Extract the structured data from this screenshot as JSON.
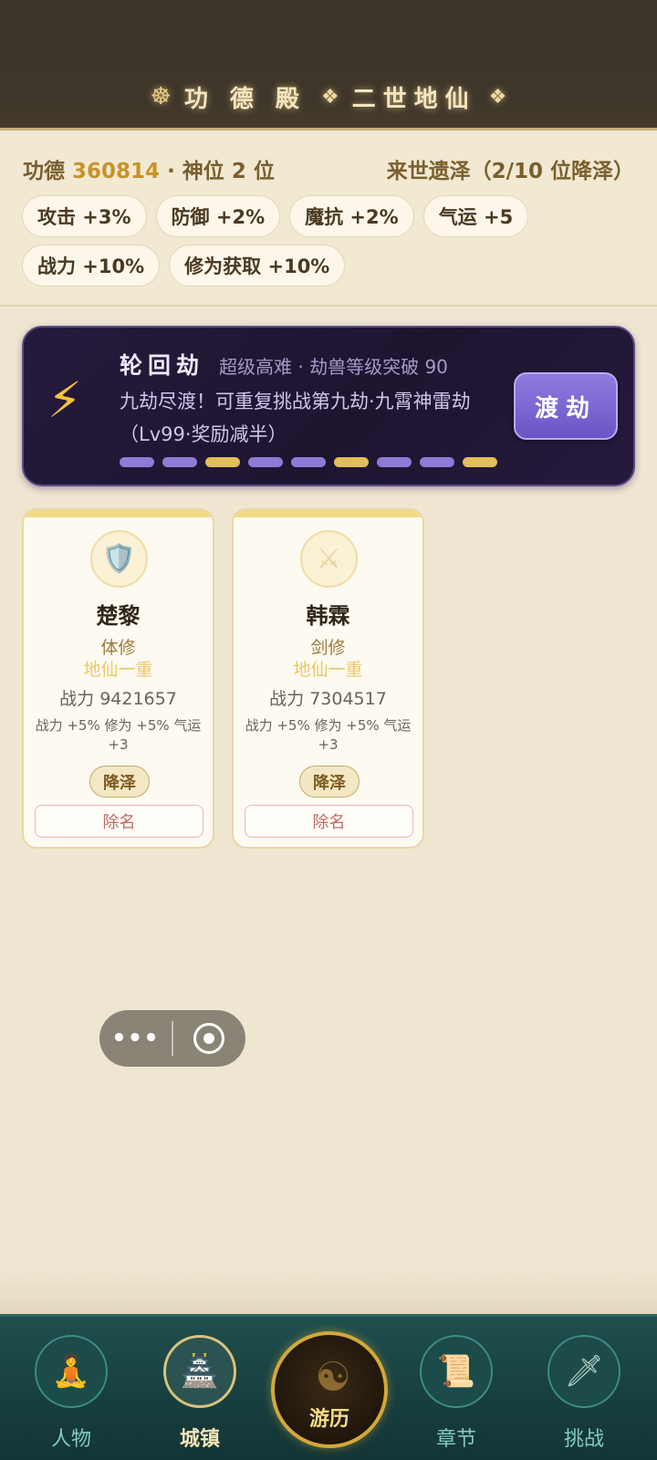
{
  "header": {
    "wheel_icon": "☸",
    "hall_name": "功德殿",
    "ornament_icon": "❖",
    "rank": "二世地仙"
  },
  "stats": {
    "merit_label": "功德",
    "merit_value": "360814",
    "slots": "· 神位 2 位",
    "legacy": "来世遗泽（2/10 位降泽）",
    "chips": [
      "攻击 +3%",
      "防御 +2%",
      "魔抗 +2%",
      "气运 +5",
      "战力 +10%",
      "修为获取 +10%"
    ]
  },
  "tribulation": {
    "icon": "⚡",
    "title": "轮回劫",
    "subtitle": "超级高难 · 劫兽等级突破 90",
    "description": "九劫尽渡！可重复挑战第九劫·九霄神雷劫（Lv99·奖励减半）",
    "progress": [
      "done",
      "done",
      "gold",
      "done",
      "done",
      "gold",
      "done",
      "done",
      "gold"
    ],
    "button_label": "渡劫",
    "colors": {
      "accent": "#7a66d4",
      "gold": "#e2bd58"
    }
  },
  "members": [
    {
      "avatar_icon": "🛡️",
      "name": "楚黎",
      "class": "体修",
      "realm": "地仙一重",
      "power": "战力 9421657",
      "bonus": "战力 +5% 修为 +5% 气运 +3",
      "bless_label": "降泽",
      "remove_label": "除名"
    },
    {
      "avatar_icon": "⚔",
      "name": "韩霖",
      "class": "剑修",
      "realm": "地仙一重",
      "power": "战力 7304517",
      "bonus": "战力 +5% 修为 +5% 气运 +3",
      "bless_label": "降泽",
      "remove_label": "除名"
    }
  ],
  "capsule": {
    "more_icon": "•••",
    "close_icon": "target"
  },
  "nav": {
    "items": [
      {
        "label": "人物",
        "icon": "🧘"
      },
      {
        "label": "城镇",
        "icon": "🏯"
      },
      {
        "label": "游历",
        "icon": "☯"
      },
      {
        "label": "章节",
        "icon": "📜"
      },
      {
        "label": "挑战",
        "icon": "🗡"
      }
    ]
  }
}
